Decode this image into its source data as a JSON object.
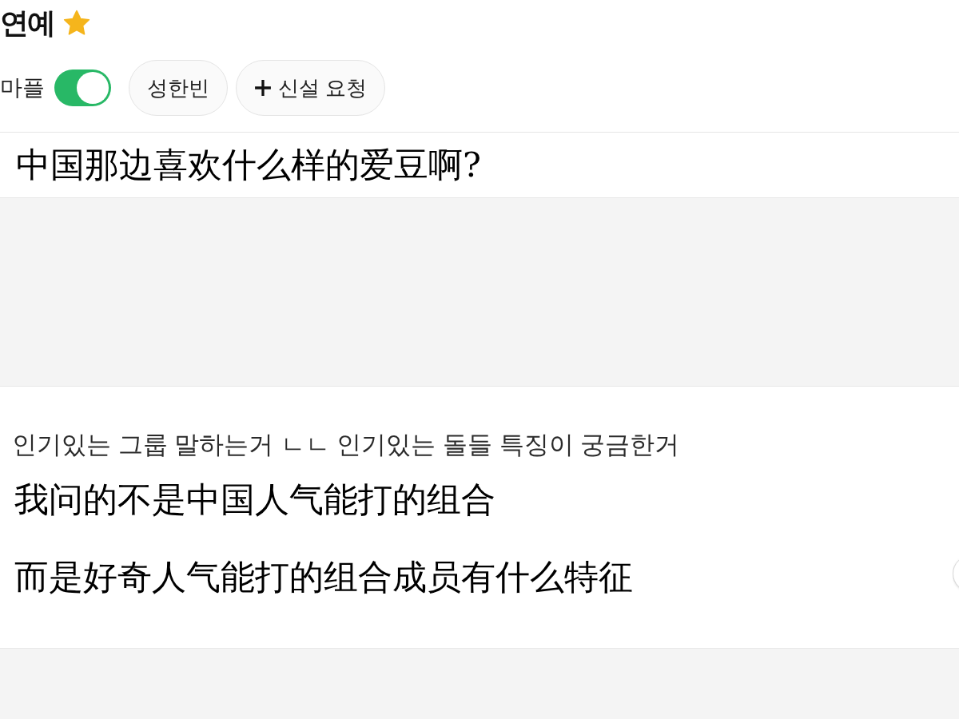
{
  "header": {
    "title": "연예",
    "favorite": true
  },
  "filters": {
    "toggle": {
      "label": "마플",
      "on": true
    },
    "chips": [
      {
        "label": "성한빈",
        "kind": "chip"
      },
      {
        "label": "신설 요청",
        "kind": "add"
      }
    ]
  },
  "posts": [
    {
      "lines": [
        {
          "kind": "caption",
          "text": "中国那边喜欢什么样的爱豆啊?"
        }
      ]
    },
    {
      "lines": [
        {
          "kind": "comment",
          "text": "인기있는 그룹 말하는거 ㄴㄴ 인기있는 돌들 특징이 궁금한거"
        },
        {
          "kind": "caption",
          "text": "我问的不是中国人气能打的组合"
        },
        {
          "kind": "caption",
          "text": "而是好奇人气能打的组合成员有什么特征"
        }
      ]
    }
  ]
}
